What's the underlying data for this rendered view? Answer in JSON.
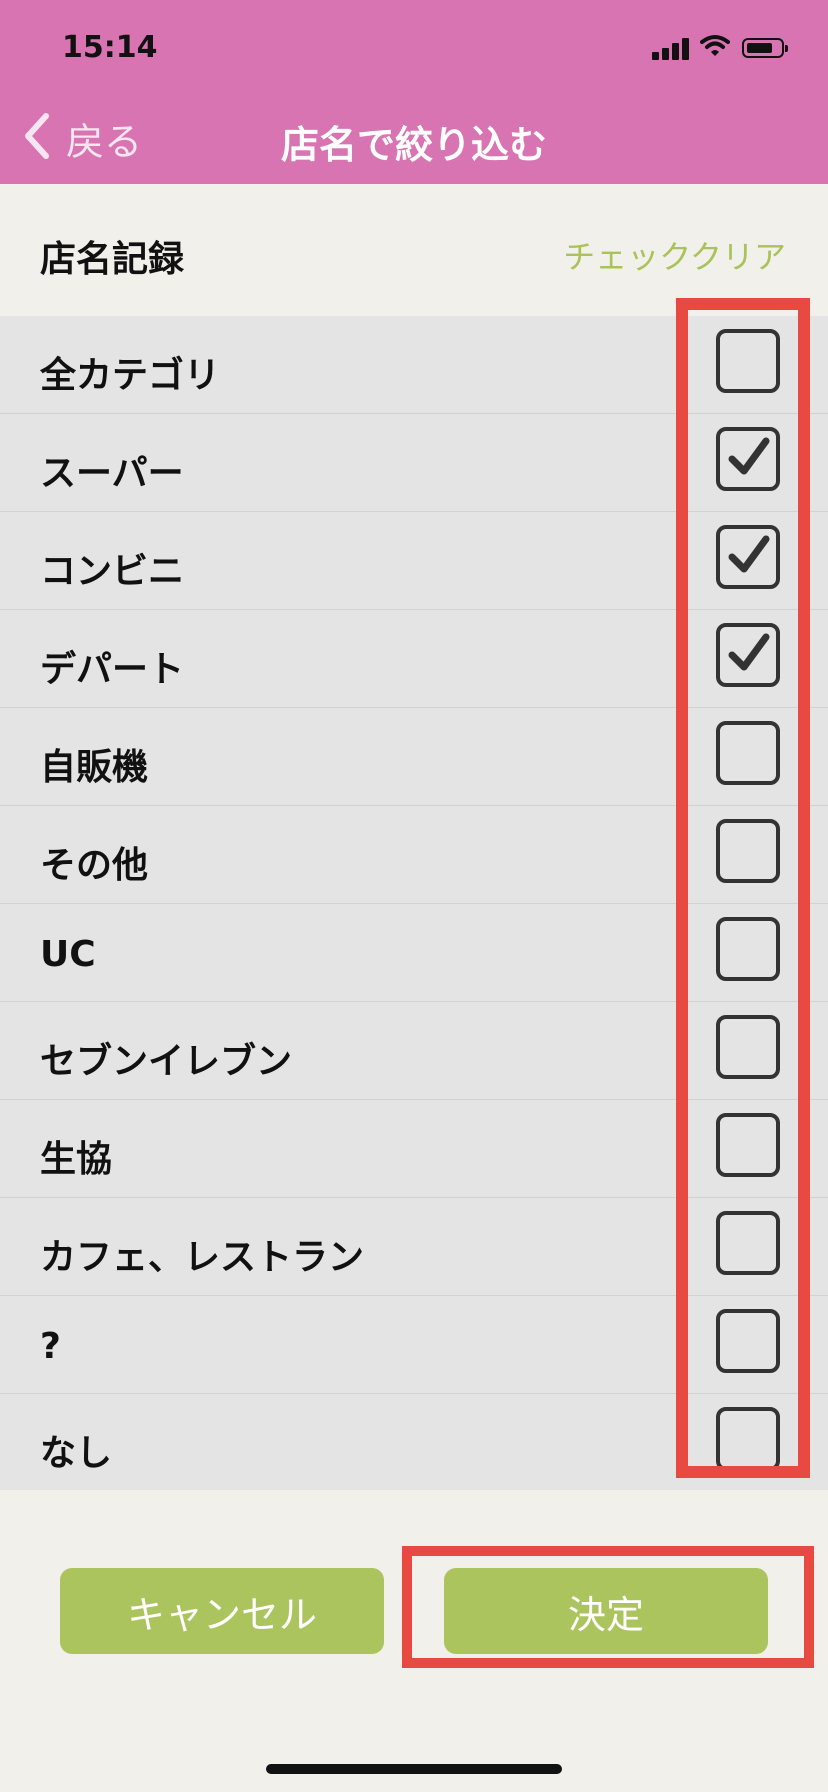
{
  "status": {
    "time": "15:14"
  },
  "nav": {
    "back_label": "戻る",
    "title": "店名で絞り込む"
  },
  "section": {
    "title": "店名記録",
    "clear_label": "チェッククリア"
  },
  "items": [
    {
      "label": "全カテゴリ",
      "checked": false
    },
    {
      "label": "スーパー",
      "checked": true
    },
    {
      "label": "コンビニ",
      "checked": true
    },
    {
      "label": "デパート",
      "checked": true
    },
    {
      "label": "自販機",
      "checked": false
    },
    {
      "label": "その他",
      "checked": false
    },
    {
      "label": "UC",
      "checked": false
    },
    {
      "label": "セブンイレブン",
      "checked": false
    },
    {
      "label": "生協",
      "checked": false
    },
    {
      "label": "カフェ、レストラン",
      "checked": false
    },
    {
      "label": "?",
      "checked": false
    },
    {
      "label": "なし",
      "checked": false
    }
  ],
  "buttons": {
    "cancel_label": "キャンセル",
    "ok_label": "決定"
  },
  "colors": {
    "header": "#d874b2",
    "accent": "#acc45d",
    "highlight": "#e84a42"
  }
}
